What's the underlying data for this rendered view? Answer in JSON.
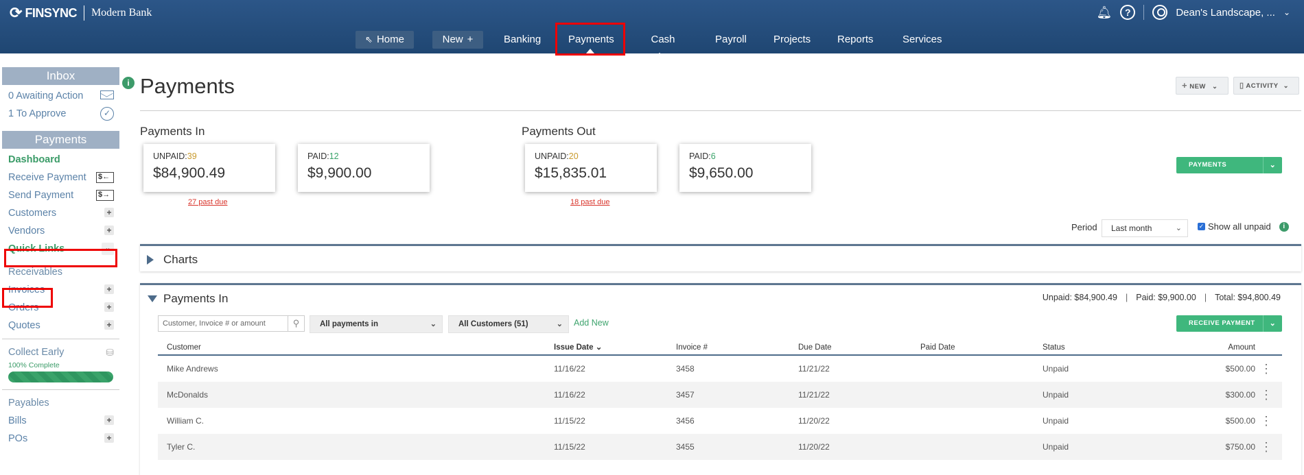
{
  "brand": {
    "logo": "FINSYNC",
    "bank": "Modern Bank"
  },
  "top_right": {
    "user": "Dean's Landscape, ..."
  },
  "nav": [
    {
      "label": "Home",
      "icon": "arrow-up-left-icon"
    },
    {
      "label": "New",
      "icon": "plus-icon"
    },
    {
      "label": "Banking"
    },
    {
      "label": "Payments"
    },
    {
      "label": "Cash Flow"
    },
    {
      "label": "Payroll"
    },
    {
      "label": "Projects"
    },
    {
      "label": "Reports"
    },
    {
      "label": "Services"
    }
  ],
  "sidebar": {
    "inbox_title": "Inbox",
    "awaiting": "0 Awaiting Action",
    "to_approve": "1 To Approve",
    "payments_title": "Payments",
    "dashboard": "Dashboard",
    "receive_payment": "Receive Payment",
    "send_payment": "Send Payment",
    "customers": "Customers",
    "vendors": "Vendors",
    "quick_links": "Quick Links",
    "receivables": "Receivables",
    "invoices": "Invoices",
    "orders": "Orders",
    "quotes": "Quotes",
    "collect_early": "Collect Early",
    "complete": "100% Complete",
    "complete_value": 100,
    "payables": "Payables",
    "bills": "Bills",
    "pos": "POs"
  },
  "page": {
    "title": "Payments",
    "new_btn": "NEW",
    "activity_btn": "ACTIVITY"
  },
  "summary": {
    "in_title": "Payments In",
    "out_title": "Payments Out",
    "in_unpaid_label": "UNPAID:",
    "in_unpaid_count": "39",
    "in_unpaid_amount": "$84,900.49",
    "in_past_due": "27 past due",
    "in_paid_label": "PAID:",
    "in_paid_count": "12",
    "in_paid_amount": "$9,900.00",
    "out_unpaid_label": "UNPAID:",
    "out_unpaid_count": "20",
    "out_unpaid_amount": "$15,835.01",
    "out_past_due": "18 past due",
    "out_paid_label": "PAID:",
    "out_paid_count": "6",
    "out_paid_amount": "$9,650.00",
    "payments_btn": "PAYMENTS"
  },
  "filters": {
    "period_label": "Period",
    "period_value": "Last month",
    "show_unpaid": "Show all unpaid"
  },
  "charts_title": "Charts",
  "payments_in": {
    "title": "Payments In",
    "unpaid": "Unpaid: $84,900.49",
    "paid": "Paid: $9,900.00",
    "total": "Total: $94,800.49",
    "search_placeholder": "Customer, Invoice # or amount",
    "filter_type": "All payments in",
    "filter_customers": "All Customers (51)",
    "add_new": "Add New",
    "receive_btn": "RECEIVE PAYMENT",
    "columns": [
      "Customer",
      "Issue Date",
      "Invoice #",
      "Due Date",
      "Paid Date",
      "Status",
      "Amount"
    ],
    "rows": [
      {
        "customer": "Mike Andrews",
        "issue": "11/16/22",
        "invoice": "3458",
        "due": "11/21/22",
        "paid": "",
        "status": "Unpaid",
        "amount": "$500.00"
      },
      {
        "customer": "McDonalds",
        "issue": "11/16/22",
        "invoice": "3457",
        "due": "11/21/22",
        "paid": "",
        "status": "Unpaid",
        "amount": "$300.00"
      },
      {
        "customer": "William C.",
        "issue": "11/15/22",
        "invoice": "3456",
        "due": "11/20/22",
        "paid": "",
        "status": "Unpaid",
        "amount": "$500.00"
      },
      {
        "customer": "Tyler C.",
        "issue": "11/15/22",
        "invoice": "3455",
        "due": "11/20/22",
        "paid": "",
        "status": "Unpaid",
        "amount": "$750.00"
      }
    ]
  },
  "colors": {
    "nav_bg": "#1f4672",
    "accent_green": "#3fb77d",
    "highlight_red": "#e00000"
  }
}
